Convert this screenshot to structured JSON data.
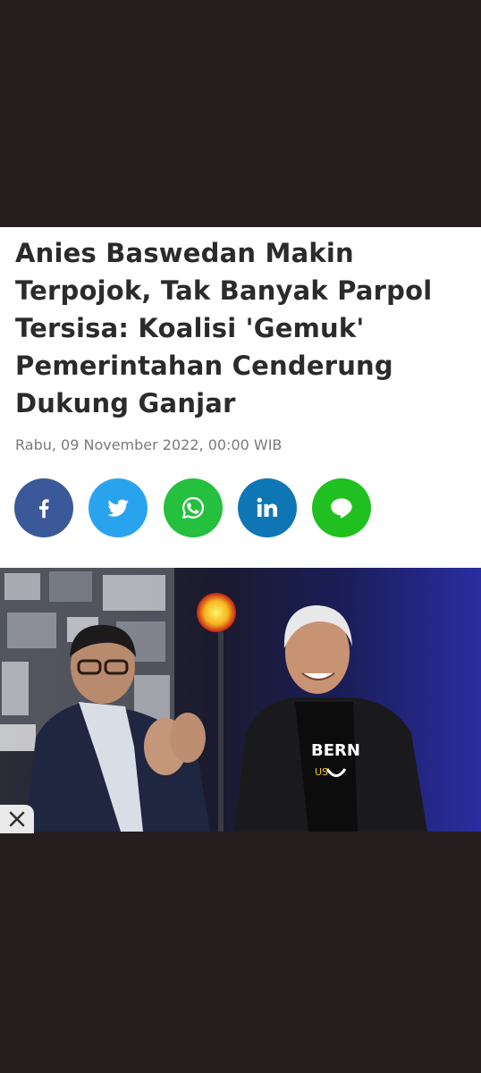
{
  "article": {
    "title": "Anies Baswedan Makin Terpojok, Tak Banyak Parpol Tersisa: Koalisi 'Gemuk' Pemerintahan Cenderung Dukung Ganjar",
    "date": "Rabu, 09 November 2022, 00:00 WIB"
  },
  "share": {
    "buttons": [
      {
        "name": "facebook",
        "icon": "facebook-icon",
        "color": "#3b5998"
      },
      {
        "name": "twitter",
        "icon": "twitter-icon",
        "color": "#2aa3ef"
      },
      {
        "name": "whatsapp",
        "icon": "whatsapp-icon",
        "color": "#25c03e"
      },
      {
        "name": "linkedin",
        "icon": "linkedin-icon",
        "color": "#0e76b4"
      },
      {
        "name": "line",
        "icon": "line-icon",
        "color": "#1fc01f"
      }
    ],
    "line_label": "LINE"
  },
  "photo": {
    "shirt_text": "BERN",
    "shirt_text_2": "US"
  },
  "ad": {
    "close_icon": "close-icon"
  },
  "colors": {
    "background": "#241e1e",
    "title": "#2b2b2b",
    "date": "#7a7a7a"
  }
}
